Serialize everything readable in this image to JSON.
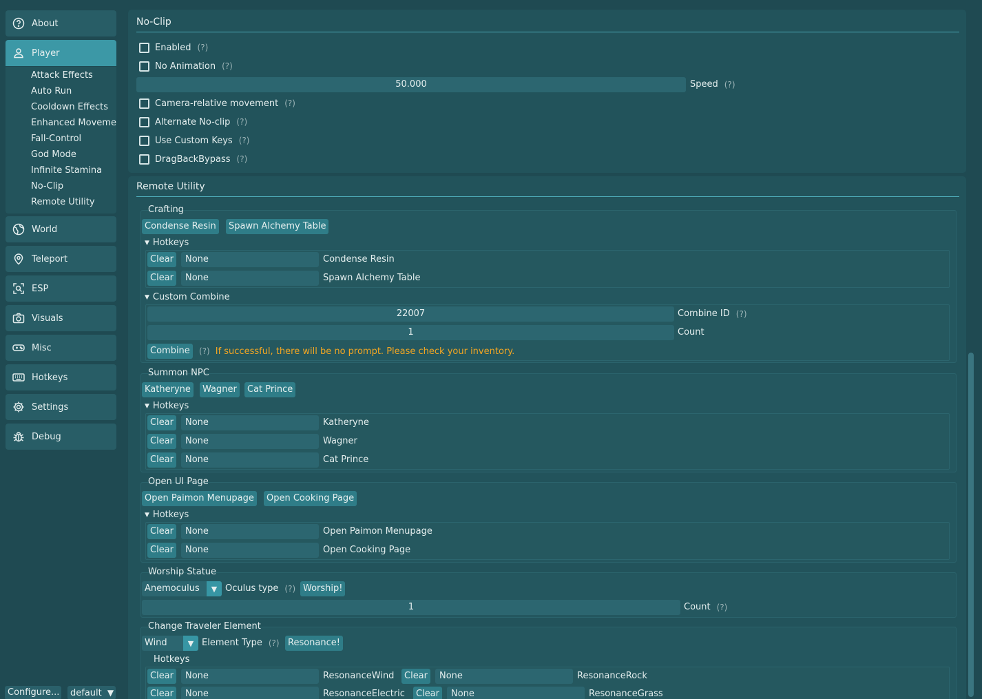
{
  "sidebar": {
    "items": [
      {
        "label": "About",
        "icon": "help-circle-icon"
      },
      {
        "label": "Player",
        "icon": "user-icon"
      },
      {
        "label": "World",
        "icon": "globe-icon"
      },
      {
        "label": "Teleport",
        "icon": "map-pin-icon"
      },
      {
        "label": "ESP",
        "icon": "scan-icon"
      },
      {
        "label": "Visuals",
        "icon": "camera-icon"
      },
      {
        "label": "Misc",
        "icon": "gamepad-icon"
      },
      {
        "label": "Hotkeys",
        "icon": "keyboard-icon"
      },
      {
        "label": "Settings",
        "icon": "gear-icon"
      },
      {
        "label": "Debug",
        "icon": "bug-icon"
      }
    ],
    "player_subitems": [
      "Attack Effects",
      "Auto Run",
      "Cooldown Effects",
      "Enhanced Moveme",
      "Fall-Control",
      "God Mode",
      "Infinite Stamina",
      "No-Clip",
      "Remote Utility"
    ],
    "bottom": {
      "configure_label": "Configure...",
      "profile_label": "default"
    }
  },
  "noclip": {
    "title": "No-Clip",
    "help": "(?)",
    "enabled": "Enabled",
    "no_animation": "No Animation",
    "speed_value": "50.000",
    "speed_label": "Speed",
    "camera_relative": "Camera-relative movement",
    "alternate": "Alternate No-clip",
    "custom_keys": "Use Custom Keys",
    "dragback": "DragBackBypass"
  },
  "remote": {
    "title": "Remote Utility",
    "clear": "Clear",
    "none": "None",
    "hotkeys": "Hotkeys",
    "crafting": {
      "title": "Crafting",
      "buttons": [
        "Condense Resin",
        "Spawn Alchemy Table"
      ],
      "hotkeys": [
        "Condense Resin",
        "Spawn Alchemy Table"
      ],
      "custom_title": "Custom Combine",
      "combine_id": "22007",
      "combine_id_label": "Combine ID",
      "count_value": "1",
      "count_label": "Count",
      "combine_button": "Combine",
      "combine_note": "If successful, there will be no prompt. Please check your inventory."
    },
    "summon": {
      "title": "Summon NPC",
      "buttons": [
        "Katheryne",
        "Wagner",
        "Cat Prince"
      ],
      "hotkeys": [
        "Katheryne",
        "Wagner",
        "Cat Prince"
      ]
    },
    "openui": {
      "title": "Open UI Page",
      "buttons": [
        "Open Paimon Menupage",
        "Open Cooking Page"
      ],
      "hotkeys": [
        "Open Paimon Menupage",
        "Open Cooking Page"
      ]
    },
    "worship": {
      "title": "Worship Statue",
      "oculus_value": "Anemoculus",
      "oculus_label": "Oculus type",
      "button": "Worship!",
      "count_value": "1",
      "count_label": "Count"
    },
    "traveler": {
      "title": "Change Traveler Element",
      "element_value": "Wind",
      "element_label": "Element Type",
      "button": "Resonance!",
      "hotkeys": [
        "ResonanceWind",
        "ResonanceRock",
        "ResonanceElectric",
        "ResonanceGrass"
      ]
    }
  }
}
